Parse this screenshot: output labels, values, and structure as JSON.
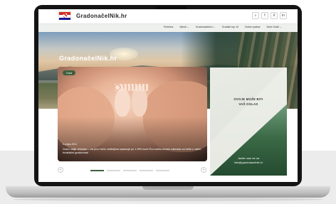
{
  "site": {
    "brand": "GradonačelNik.hr",
    "hero_logo": "GradonačelNik.hr"
  },
  "header": {
    "icons": [
      "search-icon",
      "facebook-icon",
      "x-icon",
      "linkedin-icon"
    ],
    "icon_glyphs": [
      "⌕",
      "f",
      "X",
      "in"
    ]
  },
  "nav": {
    "items": [
      "Početna",
      "Vijesti ⌄",
      "Gradonačelnici ⌄",
      "Gradski top 10",
      "Dobre prakse",
      "Moći Gradi ⌄"
    ]
  },
  "slider": {
    "tag": "Grad",
    "date": "5 ožujka 2024",
    "title": "Grad i dalje rekorder – za prvo bebe roditeljima isplaćuje po 1.990 eura! Evo kolika iznose naknada za bebe u ostim hrvatskim gradovima!",
    "active_index": 0,
    "total_slides": 5
  },
  "ad": {
    "line1": "OVOJE MOŽE BITI",
    "line2": "VAŠ OGLAS",
    "contact1": "Javite nam se na",
    "contact2": "info@gradonacelnik.hr"
  },
  "colors": {
    "accent": "#3f5f3e",
    "flag_red": "#d52b1e",
    "flag_blue": "#171796"
  }
}
